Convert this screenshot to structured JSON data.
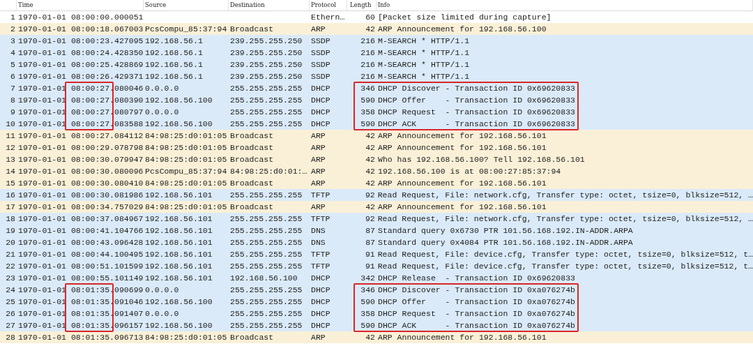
{
  "columns": [
    {
      "label": "Time"
    },
    {
      "label": "Source"
    },
    {
      "label": "Destination"
    },
    {
      "label": "Protocol"
    },
    {
      "label": "Length"
    },
    {
      "label": "Info"
    }
  ],
  "rows": [
    {
      "no": "1",
      "time": "1970-01-01 08:00:00.000051",
      "source": "",
      "destination": "",
      "protocol": "Ethern…",
      "length": "60",
      "info": "[Packet size limited during capture]",
      "color": "#ffffff",
      "marked": false
    },
    {
      "no": "2",
      "time": "1970-01-01 08:00:18.067003",
      "source": "PcsCompu_85:37:94",
      "destination": "Broadcast",
      "protocol": "ARP",
      "length": "42",
      "info": "ARP Announcement for 192.168.56.100",
      "color": "#faf0d7",
      "marked": false
    },
    {
      "no": "3",
      "time": "1970-01-01 08:00:23.427095",
      "source": "192.168.56.1",
      "destination": "239.255.255.250",
      "protocol": "SSDP",
      "length": "216",
      "info": "M-SEARCH * HTTP/1.1",
      "color": "#daeaf9",
      "marked": false
    },
    {
      "no": "4",
      "time": "1970-01-01 08:00:24.428350",
      "source": "192.168.56.1",
      "destination": "239.255.255.250",
      "protocol": "SSDP",
      "length": "216",
      "info": "M-SEARCH * HTTP/1.1",
      "color": "#daeaf9",
      "marked": false
    },
    {
      "no": "5",
      "time": "1970-01-01 08:00:25.428869",
      "source": "192.168.56.1",
      "destination": "239.255.255.250",
      "protocol": "SSDP",
      "length": "216",
      "info": "M-SEARCH * HTTP/1.1",
      "color": "#daeaf9",
      "marked": false
    },
    {
      "no": "6",
      "time": "1970-01-01 08:00:26.429371",
      "source": "192.168.56.1",
      "destination": "239.255.255.250",
      "protocol": "SSDP",
      "length": "216",
      "info": "M-SEARCH * HTTP/1.1",
      "color": "#daeaf9",
      "marked": false
    },
    {
      "no": "7",
      "time": "1970-01-01 08:00:27.080046",
      "source": "0.0.0.0",
      "destination": "255.255.255.255",
      "protocol": "DHCP",
      "length": "346",
      "info": "DHCP Discover - Transaction ID 0x69620833",
      "color": "#daeaf9",
      "marked": true
    },
    {
      "no": "8",
      "time": "1970-01-01 08:00:27.080390",
      "source": "192.168.56.100",
      "destination": "255.255.255.255",
      "protocol": "DHCP",
      "length": "590",
      "info": "DHCP Offer    - Transaction ID 0x69620833",
      "color": "#daeaf9",
      "marked": true
    },
    {
      "no": "9",
      "time": "1970-01-01 08:00:27.080797",
      "source": "0.0.0.0",
      "destination": "255.255.255.255",
      "protocol": "DHCP",
      "length": "358",
      "info": "DHCP Request  - Transaction ID 0x69620833",
      "color": "#daeaf9",
      "marked": true
    },
    {
      "no": "10",
      "time": "1970-01-01 08:00:27.083588",
      "source": "192.168.56.100",
      "destination": "255.255.255.255",
      "protocol": "DHCP",
      "length": "590",
      "info": "DHCP ACK      - Transaction ID 0x69620833",
      "color": "#daeaf9",
      "marked": true
    },
    {
      "no": "11",
      "time": "1970-01-01 08:00:27.084112",
      "source": "84:98:25:d0:01:05",
      "destination": "Broadcast",
      "protocol": "ARP",
      "length": "42",
      "info": "ARP Announcement for 192.168.56.101",
      "color": "#faf0d7",
      "marked": false
    },
    {
      "no": "12",
      "time": "1970-01-01 08:00:29.078798",
      "source": "84:98:25:d0:01:05",
      "destination": "Broadcast",
      "protocol": "ARP",
      "length": "42",
      "info": "ARP Announcement for 192.168.56.101",
      "color": "#faf0d7",
      "marked": false
    },
    {
      "no": "13",
      "time": "1970-01-01 08:00:30.079947",
      "source": "84:98:25:d0:01:05",
      "destination": "Broadcast",
      "protocol": "ARP",
      "length": "42",
      "info": "Who has 192.168.56.100? Tell 192.168.56.101",
      "color": "#faf0d7",
      "marked": false
    },
    {
      "no": "14",
      "time": "1970-01-01 08:00:30.080096",
      "source": "PcsCompu_85:37:94",
      "destination": "84:98:25:d0:01:…",
      "protocol": "ARP",
      "length": "42",
      "info": "192.168.56.100 is at 08:00:27:85:37:94",
      "color": "#faf0d7",
      "marked": false
    },
    {
      "no": "15",
      "time": "1970-01-01 08:00:30.080410",
      "source": "84:98:25:d0:01:05",
      "destination": "Broadcast",
      "protocol": "ARP",
      "length": "42",
      "info": "ARP Announcement for 192.168.56.101",
      "color": "#faf0d7",
      "marked": false
    },
    {
      "no": "16",
      "time": "1970-01-01 08:00:30.081986",
      "source": "192.168.56.101",
      "destination": "255.255.255.255",
      "protocol": "TFTP",
      "length": "92",
      "info": "Read Request, File: network.cfg, Transfer type: octet, tsize=0, blksize=512, …",
      "color": "#daeaf9",
      "marked": false
    },
    {
      "no": "17",
      "time": "1970-01-01 08:00:34.757029",
      "source": "84:98:25:d0:01:05",
      "destination": "Broadcast",
      "protocol": "ARP",
      "length": "42",
      "info": "ARP Announcement for 192.168.56.101",
      "color": "#faf0d7",
      "marked": false
    },
    {
      "no": "18",
      "time": "1970-01-01 08:00:37.084967",
      "source": "192.168.56.101",
      "destination": "255.255.255.255",
      "protocol": "TFTP",
      "length": "92",
      "info": "Read Request, File: network.cfg, Transfer type: octet, tsize=0, blksize=512, …",
      "color": "#daeaf9",
      "marked": false
    },
    {
      "no": "19",
      "time": "1970-01-01 08:00:41.104766",
      "source": "192.168.56.101",
      "destination": "255.255.255.255",
      "protocol": "DNS",
      "length": "87",
      "info": "Standard query 0x6730 PTR 101.56.168.192.IN-ADDR.ARPA",
      "color": "#daeaf9",
      "marked": false
    },
    {
      "no": "20",
      "time": "1970-01-01 08:00:43.096428",
      "source": "192.168.56.101",
      "destination": "255.255.255.255",
      "protocol": "DNS",
      "length": "87",
      "info": "Standard query 0x4084 PTR 101.56.168.192.IN-ADDR.ARPA",
      "color": "#daeaf9",
      "marked": false
    },
    {
      "no": "21",
      "time": "1970-01-01 08:00:44.100495",
      "source": "192.168.56.101",
      "destination": "255.255.255.255",
      "protocol": "TFTP",
      "length": "91",
      "info": "Read Request, File: device.cfg, Transfer type: octet, tsize=0, blksize=512, t…",
      "color": "#daeaf9",
      "marked": false
    },
    {
      "no": "22",
      "time": "1970-01-01 08:00:51.101599",
      "source": "192.168.56.101",
      "destination": "255.255.255.255",
      "protocol": "TFTP",
      "length": "91",
      "info": "Read Request, File: device.cfg, Transfer type: octet, tsize=0, blksize=512, t…",
      "color": "#daeaf9",
      "marked": false
    },
    {
      "no": "23",
      "time": "1970-01-01 08:00:55.101149",
      "source": "192.168.56.101",
      "destination": "192.168.56.100",
      "protocol": "DHCP",
      "length": "342",
      "info": "DHCP Release  - Transaction ID 0x69620833",
      "color": "#daeaf9",
      "marked": false
    },
    {
      "no": "24",
      "time": "1970-01-01 08:01:35.090699",
      "source": "0.0.0.0",
      "destination": "255.255.255.255",
      "protocol": "DHCP",
      "length": "346",
      "info": "DHCP Discover - Transaction ID 0xa076274b",
      "color": "#daeaf9",
      "marked": true
    },
    {
      "no": "25",
      "time": "1970-01-01 08:01:35.091046",
      "source": "192.168.56.100",
      "destination": "255.255.255.255",
      "protocol": "DHCP",
      "length": "590",
      "info": "DHCP Offer    - Transaction ID 0xa076274b",
      "color": "#daeaf9",
      "marked": true
    },
    {
      "no": "26",
      "time": "1970-01-01 08:01:35.091407",
      "source": "0.0.0.0",
      "destination": "255.255.255.255",
      "protocol": "DHCP",
      "length": "358",
      "info": "DHCP Request  - Transaction ID 0xa076274b",
      "color": "#daeaf9",
      "marked": true
    },
    {
      "no": "27",
      "time": "1970-01-01 08:01:35.096157",
      "source": "192.168.56.100",
      "destination": "255.255.255.255",
      "protocol": "DHCP",
      "length": "590",
      "info": "DHCP ACK      - Transaction ID 0xa076274b",
      "color": "#daeaf9",
      "marked": true
    },
    {
      "no": "28",
      "time": "1970-01-01 08:01:35.096713",
      "source": "84:98:25:d0:01:05",
      "destination": "Broadcast",
      "protocol": "ARP",
      "length": "42",
      "info": "ARP Announcement for 192.168.56.101",
      "color": "#faf0d7",
      "marked": false
    }
  ]
}
